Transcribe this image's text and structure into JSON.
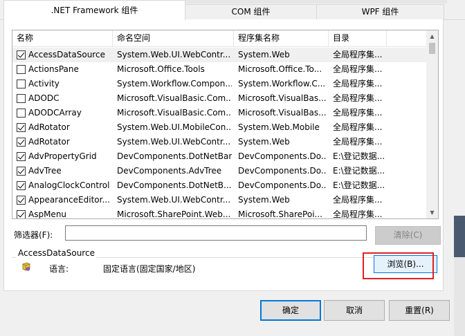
{
  "tabs": [
    {
      "label": ".NET Framework 组件",
      "active": true
    },
    {
      "label": "COM 组件",
      "active": false
    },
    {
      "label": "WPF 组件",
      "active": false
    }
  ],
  "list": {
    "columns": [
      "名称",
      "命名空间",
      "程序集名称",
      "目录"
    ],
    "rows": [
      {
        "checked": true,
        "name": "AccessDataSource",
        "namespace": "System.Web.UI.WebContr...",
        "assembly": "System.Web",
        "dir": "全局程序集...",
        "selected": true
      },
      {
        "checked": false,
        "name": "ActionsPane",
        "namespace": "Microsoft.Office.Tools",
        "assembly": "Microsoft.Office.To...",
        "dir": "全局程序集..."
      },
      {
        "checked": false,
        "name": "Activity",
        "namespace": "System.Workflow.Compon...",
        "assembly": "System.Workflow.C...",
        "dir": "全局程序集..."
      },
      {
        "checked": false,
        "name": "ADODC",
        "namespace": "Microsoft.VisualBasic.Com...",
        "assembly": "Microsoft.VisualBas...",
        "dir": "全局程序集..."
      },
      {
        "checked": false,
        "name": "ADODCArray",
        "namespace": "Microsoft.VisualBasic.Com...",
        "assembly": "Microsoft.VisualBas...",
        "dir": "全局程序集..."
      },
      {
        "checked": true,
        "name": "AdRotator",
        "namespace": "System.Web.UI.MobileCon...",
        "assembly": "System.Web.Mobile",
        "dir": "全局程序集..."
      },
      {
        "checked": true,
        "name": "AdRotator",
        "namespace": "System.Web.UI.WebContr...",
        "assembly": "System.Web",
        "dir": "全局程序集..."
      },
      {
        "checked": true,
        "name": "AdvPropertyGrid",
        "namespace": "DevComponents.DotNetBar",
        "assembly": "DevComponents.Do...",
        "dir": "E:\\登记数据..."
      },
      {
        "checked": true,
        "name": "AdvTree",
        "namespace": "DevComponents.AdvTree",
        "assembly": "DevComponents.Do...",
        "dir": "E:\\登记数据..."
      },
      {
        "checked": true,
        "name": "AnalogClockControl",
        "namespace": "DevComponents.DotNetB...",
        "assembly": "DevComponents.Do...",
        "dir": "E:\\登记数据..."
      },
      {
        "checked": true,
        "name": "AppearanceEditor...",
        "namespace": "System.Web.UI.WebContr...",
        "assembly": "System.Web",
        "dir": "全局程序集..."
      },
      {
        "checked": true,
        "name": "AspMenu",
        "namespace": "Microsoft.SharePoint.Web...",
        "assembly": "Microsoft.SharePoi...",
        "dir": "全局程序集..."
      }
    ]
  },
  "filter": {
    "label": "筛选器(F):",
    "value": "",
    "clear_label": "清除(C)"
  },
  "info": {
    "title": "AccessDataSource",
    "lang_label": "语言:",
    "lang_value": "固定语言(固定国家/地区)",
    "browse_label": "浏览(B)..."
  },
  "buttons": {
    "ok": "确定",
    "cancel": "取消",
    "reset": "重置(R)"
  },
  "colors": {
    "accent": "#0078d7",
    "highlight": "#e02020"
  }
}
